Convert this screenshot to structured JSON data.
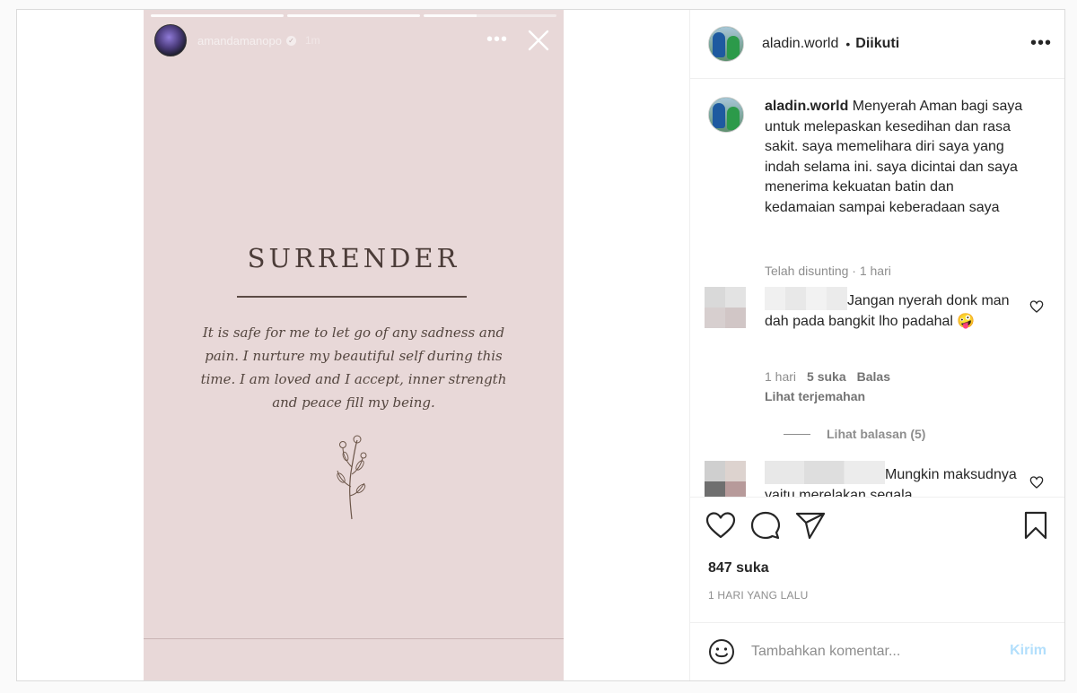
{
  "story": {
    "username": "amandamanopo",
    "time": "1m",
    "more": "•••",
    "title": "SURRENDER",
    "text": "It is safe for me to let go of any sadness and pain. I nurture my beautiful self during this time. I am loved and I accept, inner strength and peace fill my being."
  },
  "post": {
    "username": "aladin.world",
    "separator": "•",
    "follow_status": "Diikuti",
    "more": "•••",
    "caption_user": "aladin.world",
    "caption_text": " Menyerah Aman bagi saya untuk melepaskan kesedihan dan rasa sakit. saya memelihara diri saya yang indah selama ini. saya dicintai dan saya menerima kekuatan batin dan kedamaian sampai keberadaan saya",
    "caption_meta": "Telah disunting · 1 hari",
    "likes": "847 suka",
    "posted": "1 HARI YANG LALU",
    "comment_placeholder": "Tambahkan komentar...",
    "send_label": "Kirim"
  },
  "comments": [
    {
      "text": "Jangan nyerah donk man dah pada bangkit lho padahal",
      "emoji": "🤪",
      "time": "1 hari",
      "likes": "5 suka",
      "reply": "Balas",
      "translate": "Lihat terjemahan",
      "view_replies": "Lihat balasan (5)"
    },
    {
      "text": "Mungkin maksudnya yaitu merelakan segala"
    }
  ]
}
